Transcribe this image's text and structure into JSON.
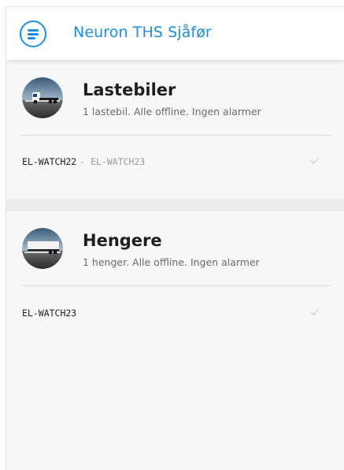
{
  "app": {
    "title": "Neuron THS Sjåfør",
    "menu_icon": "menu-lines-icon",
    "accent_color": "#1a8fe3"
  },
  "groups": [
    {
      "title": "Lastebiler",
      "summary": "1 lastebil. Alle offline. Ingen alarmer",
      "icon": "truck-icon",
      "items": [
        {
          "name": "EL-WATCH22",
          "secondary": "- EL-WATCH23",
          "status_icon": "check-icon"
        }
      ]
    },
    {
      "title": "Hengere",
      "summary": "1 henger. Alle offline. Ingen alarmer",
      "icon": "trailer-icon",
      "items": [
        {
          "name": "EL-WATCH23",
          "secondary": "",
          "status_icon": "check-icon"
        }
      ]
    }
  ]
}
